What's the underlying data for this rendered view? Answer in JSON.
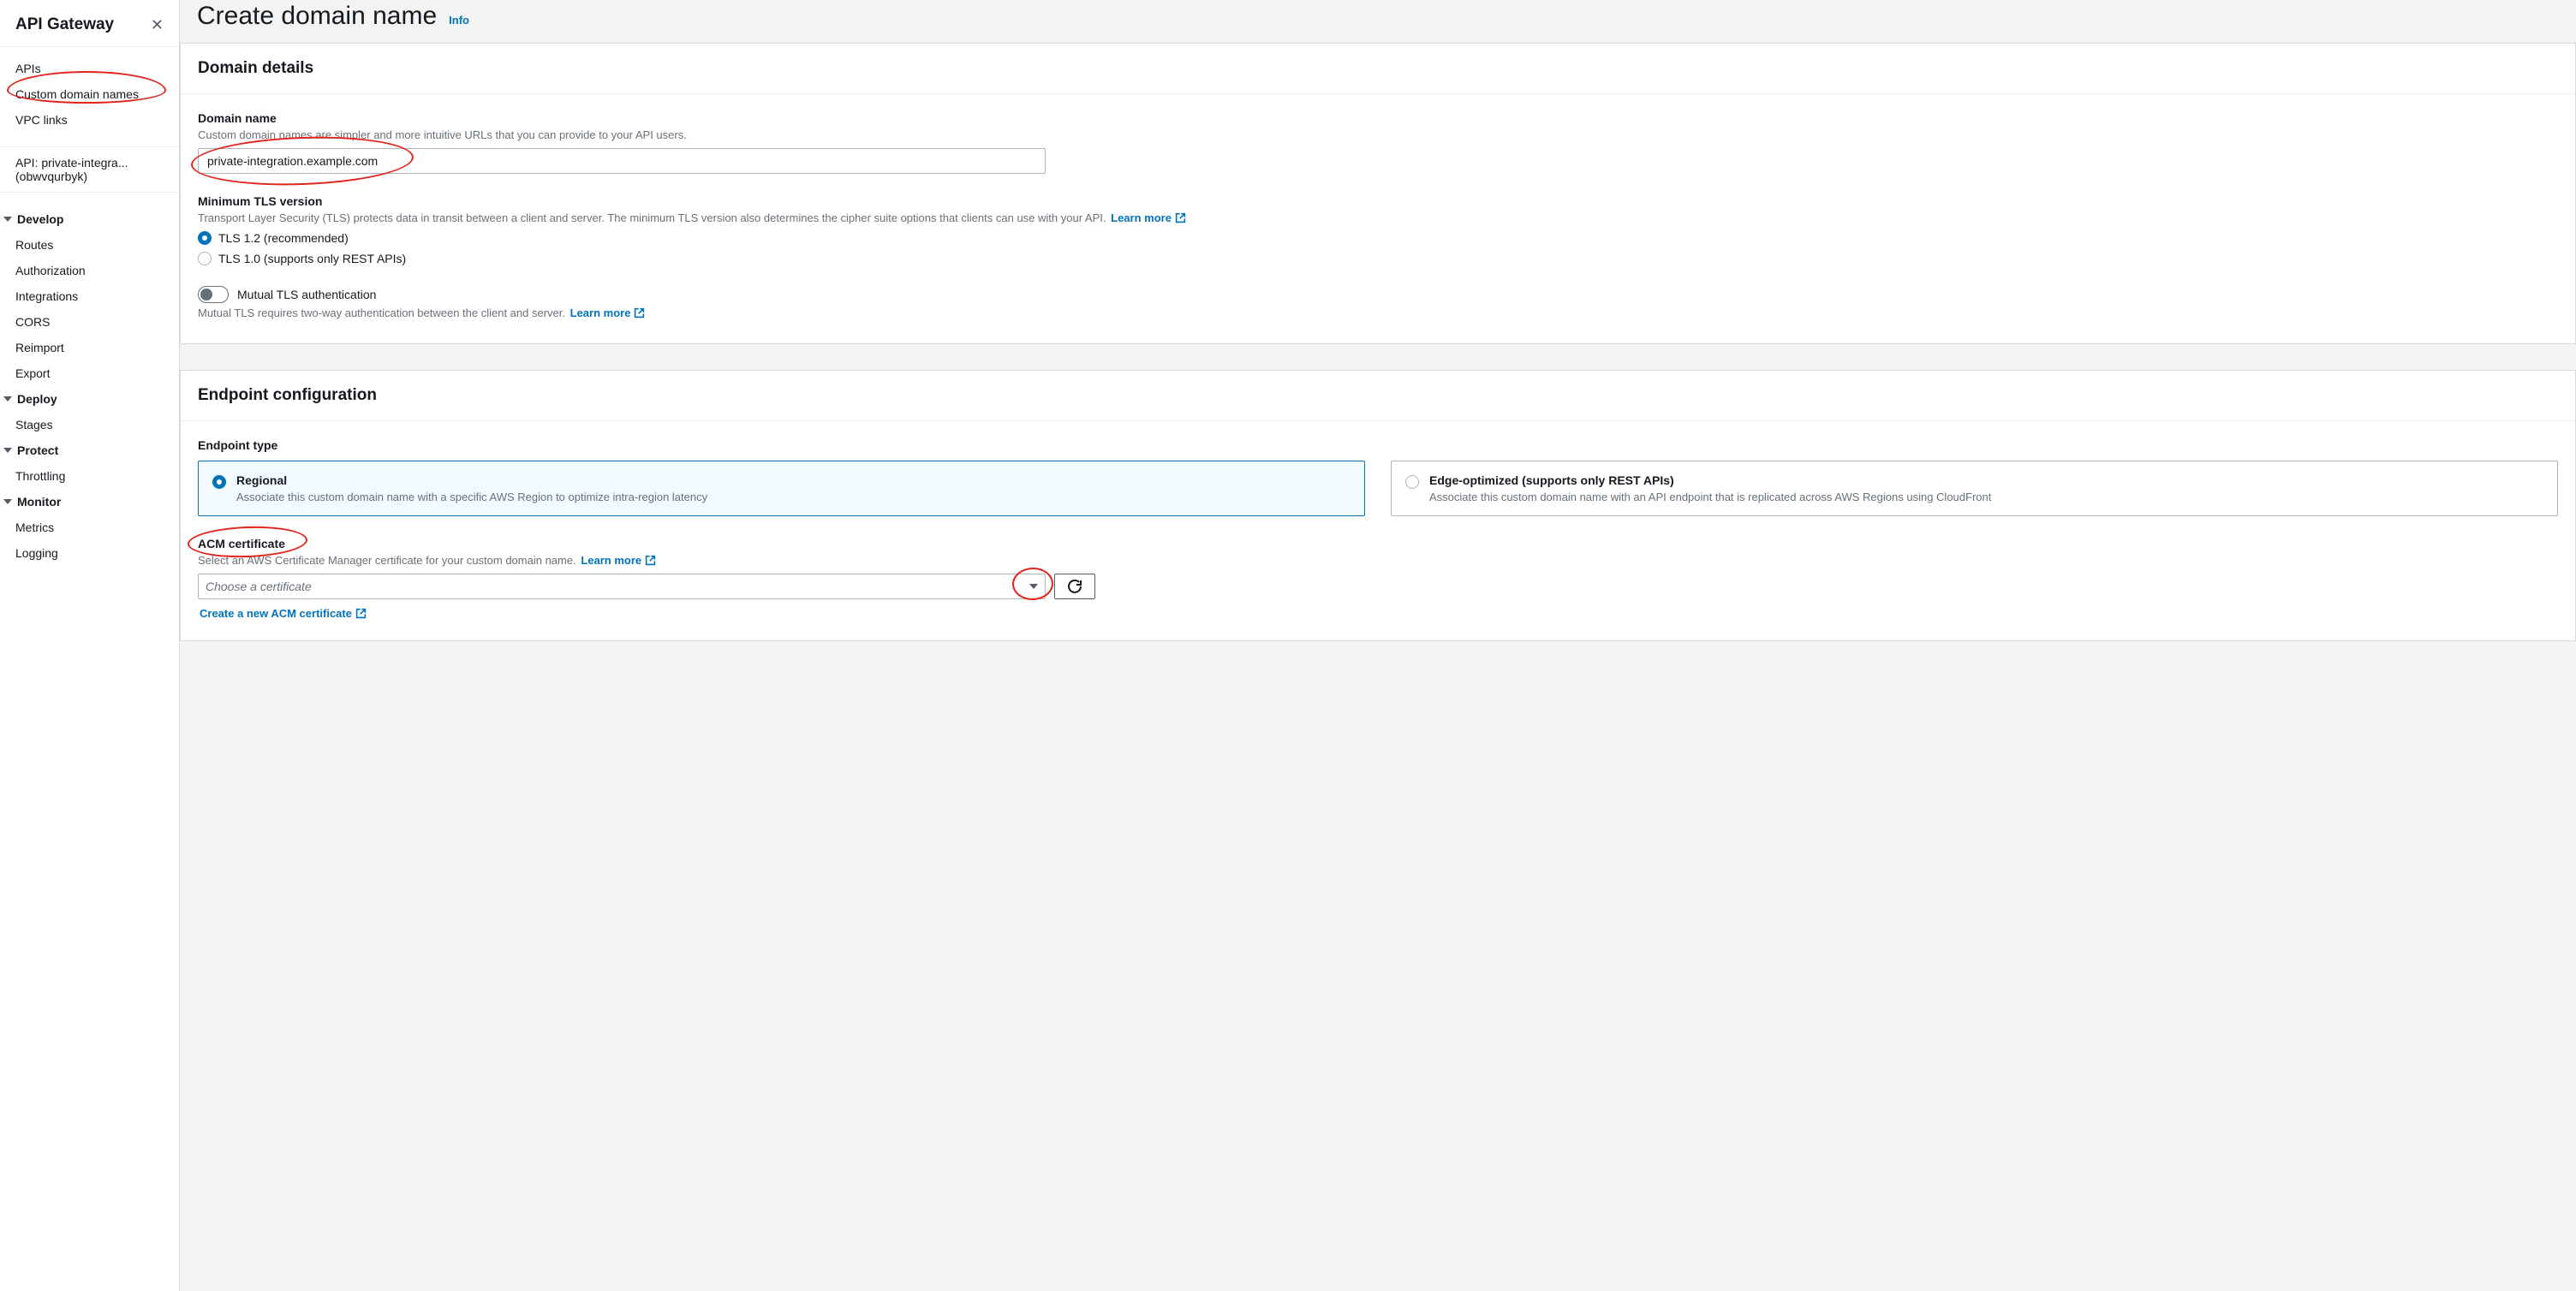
{
  "sidebar": {
    "title": "API Gateway",
    "top_items": [
      "APIs",
      "Custom domain names",
      "VPC links"
    ],
    "api_line1": "API: private-integra...",
    "api_line2": "(obwvqurbyk)",
    "groups": [
      {
        "name": "Develop",
        "items": [
          "Routes",
          "Authorization",
          "Integrations",
          "CORS",
          "Reimport",
          "Export"
        ]
      },
      {
        "name": "Deploy",
        "items": [
          "Stages"
        ]
      },
      {
        "name": "Protect",
        "items": [
          "Throttling"
        ]
      },
      {
        "name": "Monitor",
        "items": [
          "Metrics",
          "Logging"
        ]
      }
    ]
  },
  "page": {
    "title": "Create domain name",
    "info": "Info"
  },
  "domain_panel": {
    "header": "Domain details",
    "dn_label": "Domain name",
    "dn_desc": "Custom domain names are simpler and more intuitive URLs that you can provide to your API users.",
    "dn_value": "private-integration.example.com",
    "tls_label": "Minimum TLS version",
    "tls_desc": "Transport Layer Security (TLS) protects data in transit between a client and server. The minimum TLS version also determines the cipher suite options that clients can use with your API.",
    "tls_learn": "Learn more",
    "tls_opt1": "TLS 1.2 (recommended)",
    "tls_opt2": "TLS 1.0 (supports only REST APIs)",
    "mtls_label": "Mutual TLS authentication",
    "mtls_desc": "Mutual TLS requires two-way authentication between the client and server.",
    "mtls_learn": "Learn more"
  },
  "endpoint_panel": {
    "header": "Endpoint configuration",
    "type_label": "Endpoint type",
    "regional_label": "Regional",
    "regional_desc": "Associate this custom domain name with a specific AWS Region to optimize intra-region latency",
    "edge_label": "Edge-optimized (supports only REST APIs)",
    "edge_desc": "Associate this custom domain name with an API endpoint that is replicated across AWS Regions using CloudFront",
    "acm_label": "ACM certificate",
    "acm_desc": "Select an AWS Certificate Manager certificate for your custom domain name.",
    "acm_learn": "Learn more",
    "acm_placeholder": "Choose a certificate",
    "acm_create": "Create a new ACM certificate"
  }
}
